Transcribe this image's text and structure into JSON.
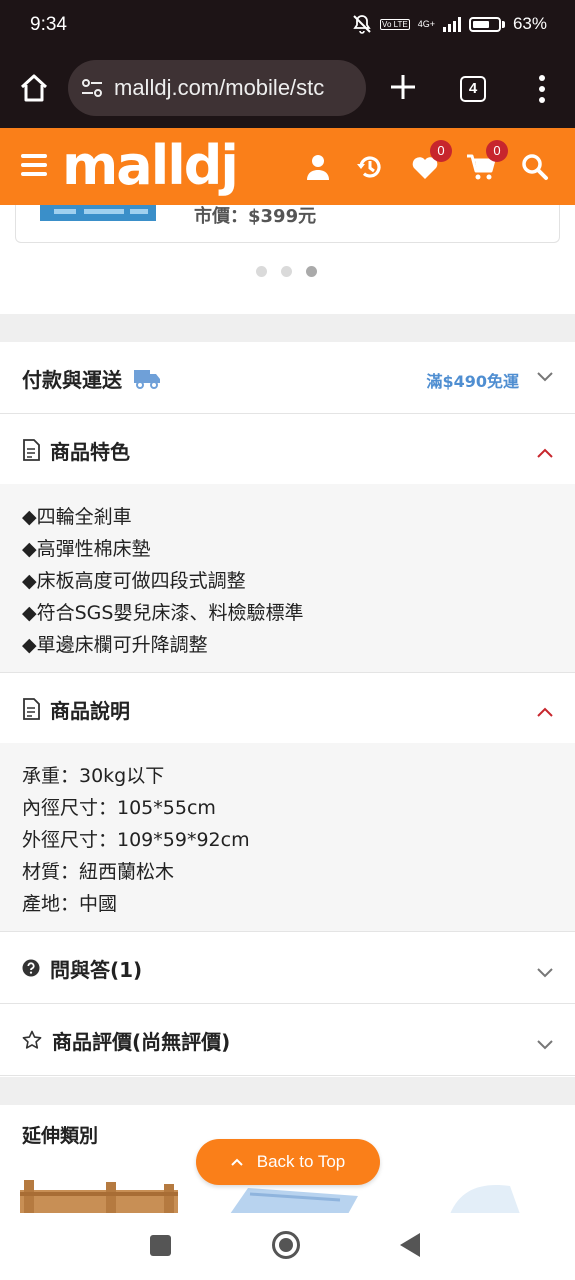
{
  "status_bar": {
    "time": "9:34",
    "network": "4G+",
    "volte": "Vo LTE",
    "battery": "63%"
  },
  "browser": {
    "url": "malldj.com/mobile/stc",
    "tab_count": "4"
  },
  "header": {
    "logo": "malldj",
    "wishlist_count": "0",
    "cart_count": "0",
    "brand_color": "#fa7f19"
  },
  "carousel": {
    "price_fragment": "市價：$399元",
    "dots": 3,
    "active_dot": 3
  },
  "sections": {
    "payment": {
      "title": "付款與運送",
      "shipping_note": "滿$490免運"
    },
    "features": {
      "title": "商品特色",
      "items": [
        "◆四輪全剎車",
        "◆高彈性棉床墊",
        "◆床板高度可做四段式調整",
        "◆符合SGS嬰兒床漆、料檢驗標準",
        "◆單邊床欄可升降調整"
      ]
    },
    "description": {
      "title": "商品說明",
      "items": [
        "承重：30kg以下",
        "內徑尺寸：105*55cm",
        "外徑尺寸：109*59*92cm",
        "材質：紐西蘭松木",
        "產地：中國"
      ]
    },
    "qa": {
      "title": "問與答(1)"
    },
    "reviews": {
      "title": "商品評價(尚無評價)"
    }
  },
  "extended": {
    "title": "延伸類別"
  },
  "back_to_top": "Back to Top"
}
